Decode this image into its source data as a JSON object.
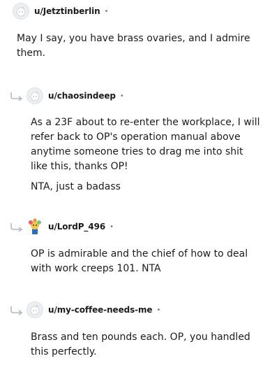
{
  "comments": [
    {
      "username": "u/Jetztinberlin",
      "separator": "•",
      "paragraphs": [
        "May I say, you have brass ovaries, and I admire them."
      ],
      "is_reply": false,
      "avatar": "default-snoo-avatar-icon"
    },
    {
      "username": "u/chaosindeep",
      "separator": "•",
      "paragraphs": [
        "As a 23F about to re-enter the workplace, I will refer back to OP's operation manual above anytime someone tries to drag me into shit like this, thanks OP!",
        "NTA, just a badass"
      ],
      "is_reply": true,
      "avatar": "default-snoo-avatar-icon"
    },
    {
      "username": "u/LordP_496",
      "separator": "•",
      "paragraphs": [
        "OP is admirable and the chief of how to deal with work creeps 101. NTA"
      ],
      "is_reply": true,
      "avatar": "custom-colorful-avatar-icon"
    },
    {
      "username": "u/my-coffee-needs-me",
      "separator": "•",
      "paragraphs": [
        "Brass and ten pounds each. OP, you handled this perfectly."
      ],
      "is_reply": true,
      "avatar": "default-snoo-avatar-icon"
    }
  ]
}
